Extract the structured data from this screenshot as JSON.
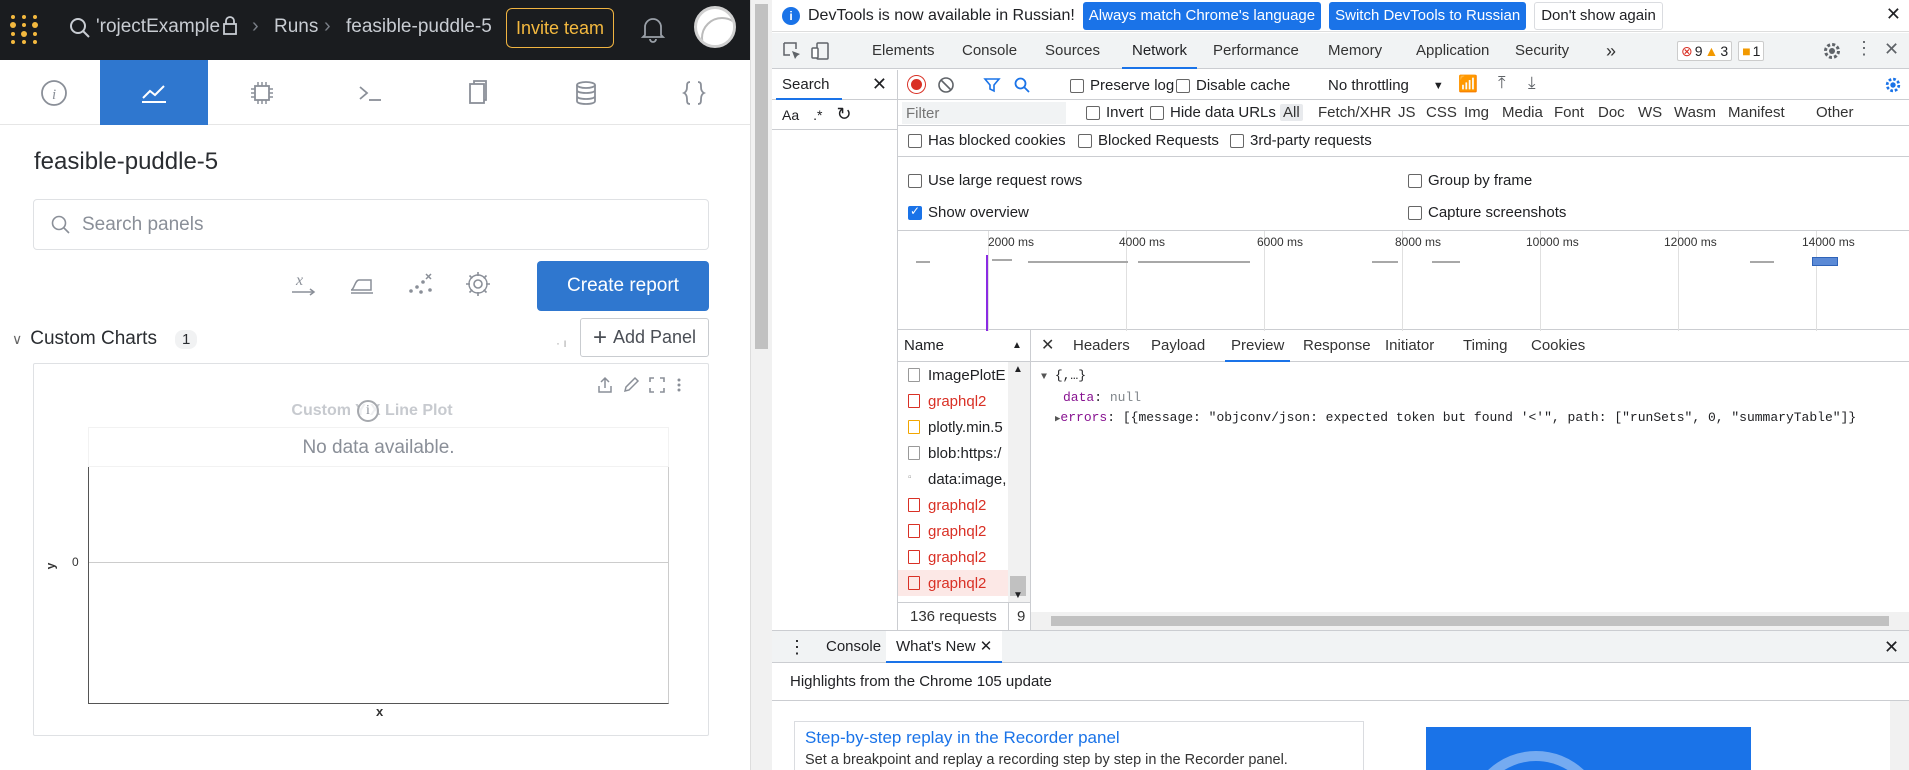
{
  "wandb": {
    "project": "'rojectExample",
    "runs": "Runs",
    "run_name": "feasible-puddle-5",
    "invite_label": "Invite team",
    "tabs": [
      "info-icon",
      "chart-icon",
      "chip-icon",
      "terminal-icon",
      "files-icon",
      "database-icon",
      "braces-icon"
    ],
    "active_tab": 1,
    "title": "feasible-puddle-5",
    "search_placeholder": "Search panels",
    "create_report": "Create report",
    "section": {
      "name": "Custom Charts",
      "count": "1"
    },
    "add_panel": "Add Panel",
    "chart": {
      "title": "Custom Y X Line Plot",
      "no_data": "No data available.",
      "ylabel": "y",
      "ytick": "0",
      "xlabel": "x"
    },
    "accent": "#2f77cf",
    "invite_color": "#f4b93f"
  },
  "devtools": {
    "infobar": {
      "message": "DevTools is now available in Russian!",
      "btn1": "Always match Chrome's language",
      "btn2": "Switch DevTools to Russian",
      "btn3": "Don't show again"
    },
    "tabs": [
      "Elements",
      "Console",
      "Sources",
      "Network",
      "Performance",
      "Memory",
      "Application",
      "Security"
    ],
    "active_tab": "Network",
    "more": "»",
    "errors": "9",
    "warnings": "3",
    "issues": "1",
    "search_label": "Search",
    "search_aa": "Aa",
    "search_regex": ".*",
    "toolbar": {
      "preserve_log": "Preserve log",
      "disable_cache": "Disable cache",
      "throttling": "No throttling"
    },
    "filter": {
      "placeholder": "Filter",
      "invert": "Invert",
      "hide_data_urls": "Hide data URLs",
      "types": [
        "All",
        "Fetch/XHR",
        "JS",
        "CSS",
        "Img",
        "Media",
        "Font",
        "Doc",
        "WS",
        "Wasm",
        "Manifest",
        "Other"
      ],
      "blocked_cookies": "Has blocked cookies",
      "blocked_requests": "Blocked Requests",
      "third_party": "3rd-party requests"
    },
    "options": {
      "large_rows": "Use large request rows",
      "group_by_frame": "Group by frame",
      "show_overview": "Show overview",
      "capture_screenshots": "Capture screenshots"
    },
    "timeline_ticks": [
      "2000 ms",
      "4000 ms",
      "6000 ms",
      "8000 ms",
      "10000 ms",
      "12000 ms",
      "14000 ms"
    ],
    "requests": {
      "header": "Name",
      "rows": [
        {
          "name": "ImagePlotE",
          "type": "doc"
        },
        {
          "name": "graphql2",
          "type": "err"
        },
        {
          "name": "plotly.min.5",
          "type": "js"
        },
        {
          "name": "blob:https:/",
          "type": "doc"
        },
        {
          "name": "data:image,",
          "type": "img"
        },
        {
          "name": "graphql2",
          "type": "err"
        },
        {
          "name": "graphql2",
          "type": "err"
        },
        {
          "name": "graphql2",
          "type": "err"
        },
        {
          "name": "graphql2",
          "type": "err-sel"
        }
      ],
      "count": "136 requests",
      "count_tail": "9"
    },
    "detail_tabs": [
      "Headers",
      "Payload",
      "Preview",
      "Response",
      "Initiator",
      "Timing",
      "Cookies"
    ],
    "active_detail": "Preview",
    "preview": {
      "root": "{,…}",
      "data_key": "data",
      "data_val": "null",
      "errors_key": "errors",
      "errors_val": "[{message: \"objconv/json: expected token but found '<'\", path: [\"runSets\", 0, \"summaryTable\"]}"
    },
    "drawer": {
      "tabs": [
        "Console",
        "What's New"
      ],
      "active": "What's New",
      "highlight": "Highlights from the Chrome 105 update",
      "card_title": "Step-by-step replay in the Recorder panel",
      "card_desc": "Set a breakpoint and replay a recording step by step in the Recorder panel."
    }
  }
}
